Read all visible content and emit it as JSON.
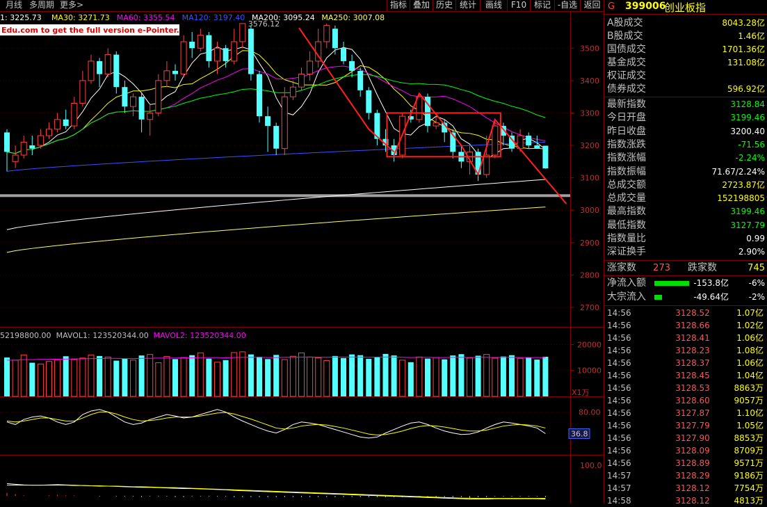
{
  "toolbar": {
    "left_items": [
      "月线",
      "多周期",
      "更多>"
    ],
    "buttons": [
      "指标",
      "叠加",
      "历史",
      "统计",
      "画线",
      "F10",
      "标记",
      "-自选",
      "返回"
    ]
  },
  "ma_legend": [
    {
      "text": "1: 3225.73",
      "color": "#ffffff"
    },
    {
      "text": "MA30: 3271.73",
      "color": "#ffff00"
    },
    {
      "text": "MA60: 3355.54",
      "color": "#ff00ff"
    },
    {
      "text": "MA120: 3197.40",
      "color": "#3a50ff"
    },
    {
      "text": "MA200: 3095.24",
      "color": "#ffffff"
    },
    {
      "text": "MA250: 3007.08",
      "color": "#ffff66"
    }
  ],
  "watermark": "Edu.com to get the full version e-Pointer.",
  "peak_label": "3576.12",
  "vol_legend": [
    {
      "text": "52198800.00",
      "color": "#c0c0c0"
    },
    {
      "text": "MAVOL1: 123520344.00",
      "color": "#c0c0c0"
    },
    {
      "text": "MAVOL2: 123520344.00",
      "color": "#ff00ff"
    }
  ],
  "vol_unit": "X1万",
  "kdj_badge": "36.8",
  "panel": {
    "code": "399006",
    "name": "创业板指",
    "g_label": "G",
    "stats": [
      {
        "label": "A股成交",
        "value": "8043.28亿"
      },
      {
        "label": "B股成交",
        "value": "1.46亿"
      },
      {
        "label": "国债成交",
        "value": "1701.36亿"
      },
      {
        "label": "基金成交",
        "value": "131.08亿"
      },
      {
        "label": "权证成交",
        "value": ""
      },
      {
        "label": "债券成交",
        "value": "596.92亿"
      }
    ],
    "quotes": [
      {
        "label": "最新指数",
        "value": "3128.84",
        "color": "#00ff00"
      },
      {
        "label": "今日开盘",
        "value": "3199.46",
        "color": "#00ff00"
      },
      {
        "label": "昨日收盘",
        "value": "3200.40",
        "color": "#ffffff"
      },
      {
        "label": "指数涨跌",
        "value": "-71.56",
        "color": "#00ff00"
      },
      {
        "label": "指数涨幅",
        "value": "-2.24%",
        "color": "#00ff00"
      },
      {
        "label": "指数振幅",
        "value": "71.67/2.24%",
        "color": "#ffffff"
      },
      {
        "label": "总成交额",
        "value": "2723.87亿",
        "color": "#ffff00"
      },
      {
        "label": "总成交量",
        "value": "152198805",
        "color": "#ffff00"
      },
      {
        "label": "最高指数",
        "value": "3199.46",
        "color": "#00ff00"
      },
      {
        "label": "最低指数",
        "value": "3127.79",
        "color": "#00ff00"
      },
      {
        "label": "指数量比",
        "value": "0.99",
        "color": "#ffffff"
      },
      {
        "label": "深证换手",
        "value": "2.90%",
        "color": "#ffffff"
      }
    ],
    "breadth": {
      "up_label": "涨家数",
      "up": "273",
      "down_label": "跌家数",
      "down": "745"
    },
    "flows": [
      {
        "label": "净流入额",
        "value": "-153.8亿",
        "pct": "-6%",
        "fill": 0.9
      },
      {
        "label": "大宗流入",
        "value": "-49.64亿",
        "pct": "-2%",
        "fill": 0.2
      }
    ],
    "ticks": [
      {
        "t": "14:56",
        "p": "3128.52",
        "q": "1.07亿"
      },
      {
        "t": "14:56",
        "p": "3128.66",
        "q": "1.02亿"
      },
      {
        "t": "14:56",
        "p": "3128.41",
        "q": "1.06亿"
      },
      {
        "t": "14:56",
        "p": "3128.23",
        "q": "1.08亿"
      },
      {
        "t": "14:56",
        "p": "3128.37",
        "q": "1.06亿"
      },
      {
        "t": "14:56",
        "p": "3128.45",
        "q": "1.04亿"
      },
      {
        "t": "14:56",
        "p": "3128.53",
        "q": "8863万"
      },
      {
        "t": "14:56",
        "p": "3128.60",
        "q": "9057万"
      },
      {
        "t": "14:56",
        "p": "3127.87",
        "q": "1.10亿"
      },
      {
        "t": "14:56",
        "p": "3127.79",
        "q": "1.05亿"
      },
      {
        "t": "14:56",
        "p": "3127.90",
        "q": "8853万"
      },
      {
        "t": "14:56",
        "p": "3128.09",
        "q": "8709万"
      },
      {
        "t": "14:56",
        "p": "3128.89",
        "q": "9571万"
      },
      {
        "t": "14:57",
        "p": "3128.29",
        "q": "9186万"
      },
      {
        "t": "14:57",
        "p": "3128.12",
        "q": "7754万"
      },
      {
        "t": "14:58",
        "p": "3128.12",
        "q": "4813万"
      }
    ]
  },
  "chart_data": [
    {
      "type": "candlestick",
      "title": "",
      "y_ticks": [
        3500,
        3400,
        3300,
        3200,
        3100,
        3000,
        2900,
        2800,
        2700
      ],
      "ylim": [
        2640,
        3610
      ],
      "bars": [
        [
          3240,
          3180,
          3250,
          3120
        ],
        [
          3150,
          3170,
          3200,
          3130
        ],
        [
          3170,
          3210,
          3230,
          3160
        ],
        [
          3200,
          3190,
          3230,
          3170
        ],
        [
          3200,
          3230,
          3250,
          3190
        ],
        [
          3230,
          3250,
          3270,
          3220
        ],
        [
          3250,
          3280,
          3300,
          3240
        ],
        [
          3280,
          3260,
          3310,
          3250
        ],
        [
          3260,
          3330,
          3350,
          3250
        ],
        [
          3330,
          3400,
          3430,
          3320
        ],
        [
          3400,
          3460,
          3480,
          3390
        ],
        [
          3460,
          3420,
          3470,
          3380
        ],
        [
          3420,
          3480,
          3500,
          3410
        ],
        [
          3480,
          3380,
          3490,
          3360
        ],
        [
          3380,
          3320,
          3400,
          3300
        ],
        [
          3320,
          3350,
          3360,
          3290
        ],
        [
          3350,
          3280,
          3360,
          3240
        ],
        [
          3280,
          3300,
          3330,
          3230
        ],
        [
          3300,
          3400,
          3420,
          3290
        ],
        [
          3400,
          3430,
          3460,
          3380
        ],
        [
          3430,
          3420,
          3450,
          3400
        ],
        [
          3420,
          3520,
          3540,
          3410
        ],
        [
          3520,
          3500,
          3550,
          3470
        ],
        [
          3500,
          3540,
          3560,
          3490
        ],
        [
          3540,
          3460,
          3550,
          3440
        ],
        [
          3460,
          3500,
          3520,
          3420
        ],
        [
          3500,
          3460,
          3510,
          3440
        ],
        [
          3460,
          3520,
          3560,
          3450
        ],
        [
          3520,
          3576,
          3576,
          3500
        ],
        [
          3560,
          3420,
          3570,
          3400
        ],
        [
          3420,
          3290,
          3430,
          3270
        ],
        [
          3290,
          3260,
          3320,
          3180
        ],
        [
          3260,
          3190,
          3270,
          3170
        ],
        [
          3190,
          3350,
          3380,
          3170
        ],
        [
          3350,
          3380,
          3400,
          3340
        ],
        [
          3380,
          3420,
          3440,
          3370
        ],
        [
          3420,
          3460,
          3490,
          3400
        ],
        [
          3460,
          3520,
          3560,
          3440
        ],
        [
          3520,
          3570,
          3576,
          3500
        ],
        [
          3560,
          3500,
          3570,
          3480
        ],
        [
          3500,
          3460,
          3520,
          3450
        ],
        [
          3460,
          3430,
          3480,
          3410
        ],
        [
          3430,
          3370,
          3440,
          3350
        ],
        [
          3370,
          3300,
          3380,
          3280
        ],
        [
          3300,
          3220,
          3310,
          3200
        ],
        [
          3220,
          3200,
          3250,
          3180
        ],
        [
          3200,
          3170,
          3220,
          3150
        ],
        [
          3170,
          3290,
          3300,
          3160
        ],
        [
          3290,
          3280,
          3310,
          3270
        ],
        [
          3280,
          3350,
          3360,
          3270
        ],
        [
          3350,
          3260,
          3360,
          3240
        ],
        [
          3260,
          3270,
          3290,
          3250
        ],
        [
          3270,
          3240,
          3280,
          3210
        ],
        [
          3240,
          3180,
          3250,
          3160
        ],
        [
          3180,
          3150,
          3200,
          3130
        ],
        [
          3150,
          3180,
          3200,
          3110
        ],
        [
          3180,
          3110,
          3190,
          3090
        ],
        [
          3110,
          3170,
          3230,
          3100
        ],
        [
          3170,
          3260,
          3280,
          3160
        ],
        [
          3260,
          3230,
          3270,
          3200
        ],
        [
          3230,
          3190,
          3240,
          3180
        ],
        [
          3190,
          3230,
          3250,
          3180
        ],
        [
          3230,
          3200,
          3240,
          3190
        ],
        [
          3200,
          3190,
          3230,
          3190
        ],
        [
          3199,
          3129,
          3199,
          3128
        ]
      ],
      "ma_lines": [
        "MA30",
        "MA60",
        "MA120",
        "MA200",
        "MA250"
      ]
    },
    {
      "type": "bar",
      "title": "VOL",
      "y_ticks": [
        20000,
        10000
      ],
      "ylim": [
        0,
        22000
      ],
      "values": [
        15000,
        14000,
        16000,
        13000,
        12500,
        13500,
        14000,
        15500,
        14200,
        14800,
        16000,
        15600,
        15200,
        13800,
        14500,
        14000,
        15800,
        16200,
        13000,
        15400,
        14400,
        15000,
        15900,
        16800,
        14600,
        13200,
        14000,
        16900,
        17200,
        16200,
        15300,
        14400,
        16000,
        14200,
        15500,
        16800,
        15200,
        14900,
        13800,
        15600,
        14800,
        16200,
        15900,
        14500,
        15100,
        16400,
        15800,
        14000,
        13200,
        15200,
        14600,
        15000,
        14300,
        15800,
        16300,
        14900,
        15700,
        16200,
        14800,
        15400,
        15900,
        14700,
        15100,
        14200,
        15300
      ],
      "mavol": [
        14000,
        14000,
        14200,
        14200,
        14300,
        14300,
        14400,
        14400,
        14500,
        14500,
        14600,
        14600,
        14700,
        14700,
        14600,
        14600,
        14700,
        14700,
        14800,
        14800,
        14800,
        14900,
        14900,
        15000,
        15000,
        15000,
        14900,
        15000,
        15100,
        15100,
        15100,
        15000,
        15000,
        15100,
        15100,
        15200,
        15200,
        15100,
        15100,
        15200,
        15200,
        15200,
        15200,
        15100,
        15200,
        15200,
        15200,
        15100,
        15000,
        15100,
        15100,
        15000,
        15000,
        15100,
        15100,
        15000,
        15100,
        15100,
        15000,
        15100,
        15100,
        15000,
        15000,
        15000,
        15000
      ]
    },
    {
      "type": "line",
      "title": "KDJ",
      "y_ticks": [
        80.0
      ],
      "ylim": [
        0,
        100
      ],
      "series": [
        {
          "color": "#ffffff",
          "values": [
            60,
            55,
            65,
            70,
            72,
            68,
            60,
            55,
            60,
            75,
            82,
            85,
            80,
            70,
            60,
            55,
            58,
            65,
            70,
            75,
            72,
            68,
            70,
            75,
            80,
            85,
            80,
            70,
            62,
            55,
            48,
            42,
            38,
            45,
            55,
            60,
            58,
            55,
            50,
            45,
            40,
            35,
            30,
            28,
            30,
            38,
            45,
            52,
            58,
            60,
            55,
            48,
            42,
            38,
            35,
            36,
            40,
            48,
            55,
            60,
            58,
            55,
            52,
            48,
            36.8
          ]
        },
        {
          "color": "#ffff00",
          "values": [
            62,
            60,
            62,
            65,
            68,
            68,
            65,
            62,
            62,
            68,
            75,
            80,
            80,
            76,
            70,
            65,
            62,
            63,
            65,
            68,
            70,
            70,
            70,
            72,
            75,
            78,
            79,
            76,
            71,
            66,
            60,
            54,
            48,
            46,
            48,
            52,
            54,
            55,
            54,
            51,
            48,
            44,
            40,
            36,
            34,
            35,
            38,
            42,
            47,
            51,
            53,
            52,
            50,
            47,
            44,
            42,
            42,
            44,
            48,
            52,
            54,
            55,
            54,
            52,
            48
          ]
        }
      ]
    },
    {
      "type": "line",
      "title": "MACD",
      "y_ticks": [
        100.0
      ],
      "ylim": [
        -20,
        120
      ],
      "series": [
        {
          "color": "#ffffff",
          "values": [
            40,
            38,
            36,
            35,
            35,
            36,
            37,
            36,
            35,
            34,
            33,
            32,
            32,
            31,
            30,
            29,
            28,
            28,
            27,
            26,
            25,
            24,
            24,
            23,
            22,
            21,
            20,
            18,
            17,
            16,
            15,
            14,
            13,
            12,
            11,
            10,
            9,
            8,
            7,
            6,
            5,
            4,
            3,
            2,
            1,
            0,
            -1,
            -2,
            -3,
            -4,
            -5,
            -6,
            -7,
            -8,
            -9,
            -10,
            -10,
            -10,
            -9,
            -9,
            -9,
            -9,
            -9,
            -9,
            -10
          ]
        },
        {
          "color": "#ffff00",
          "values": [
            35,
            35,
            35,
            35,
            35,
            35,
            35,
            35,
            34,
            34,
            33,
            33,
            32,
            32,
            31,
            30,
            30,
            29,
            28,
            27,
            27,
            26,
            25,
            24,
            23,
            22,
            21,
            20,
            19,
            18,
            17,
            16,
            15,
            14,
            13,
            12,
            11,
            10,
            9,
            8,
            7,
            6,
            5,
            4,
            3,
            2,
            1,
            0,
            -1,
            -2,
            -3,
            -4,
            -5,
            -6,
            -7,
            -7,
            -8,
            -8,
            -8,
            -8,
            -8,
            -8,
            -8,
            -8,
            -8
          ]
        }
      ]
    }
  ]
}
